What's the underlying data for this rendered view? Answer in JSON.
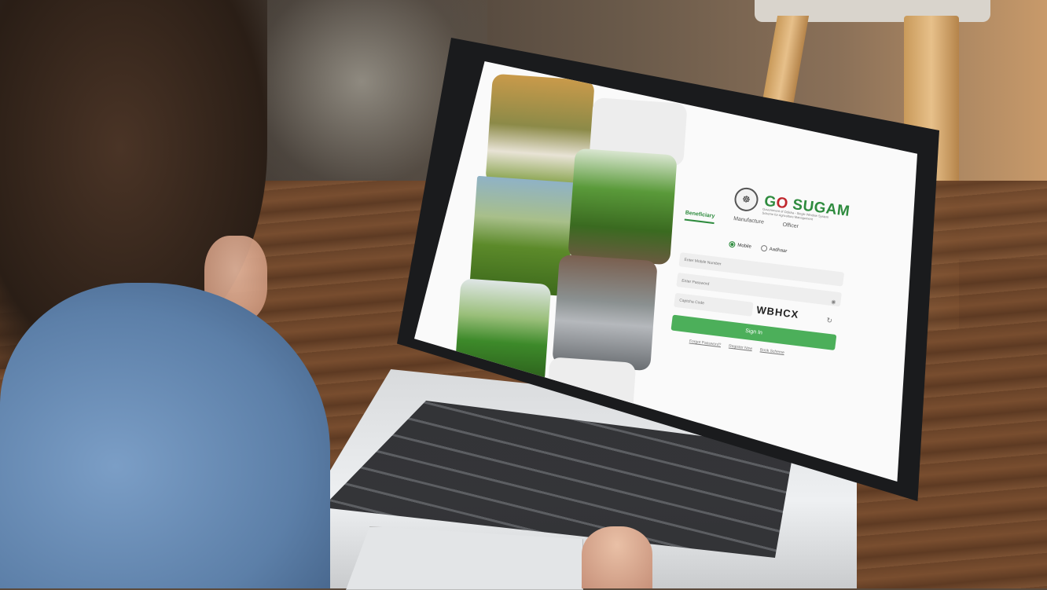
{
  "login": {
    "brand_prefix": "G",
    "brand_o": "O",
    "brand_suffix": " SUGAM",
    "subtitle": "Government of Odisha - Single Window System Scheme for Agriculture Management",
    "tabs": [
      {
        "label": "Beneficiary",
        "active": true
      },
      {
        "label": "Manufacture",
        "active": false
      },
      {
        "label": "Officer",
        "active": false
      }
    ],
    "radio_mobile": "Mobile",
    "radio_aadhaar": "Aadhaar",
    "mobile_placeholder": "Enter Mobile Number",
    "password_placeholder": "Enter Password",
    "captcha_placeholder": "Captcha Code",
    "captcha_value": "WBHCX",
    "signin_label": "Sign In",
    "links": [
      "Forgot Password?",
      "Register Now",
      "Book Scheme"
    ]
  },
  "colors": {
    "brand_green": "#2e8b3e",
    "brand_red": "#c0272d",
    "button_green": "#4caf5a"
  },
  "icons": [
    "emblem-icon",
    "eye-icon",
    "refresh-icon"
  ]
}
